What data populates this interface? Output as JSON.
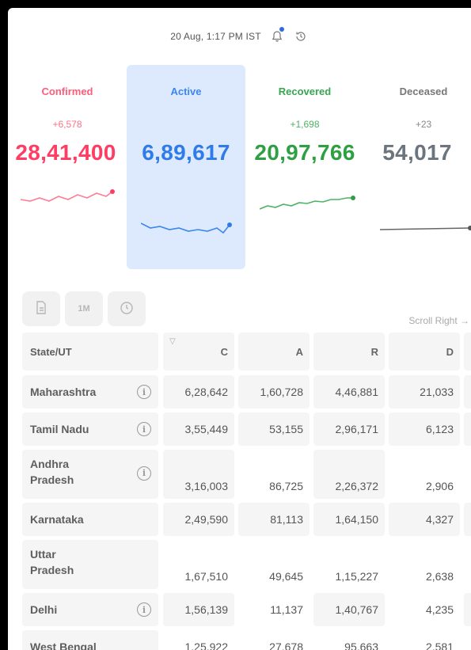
{
  "header": {
    "timestamp": "20 Aug, 1:17 PM IST"
  },
  "stats": [
    {
      "label": "Confirmed",
      "delta": "+6,578",
      "value": "28,41,400",
      "color": "#ff3d63"
    },
    {
      "label": "Active",
      "delta": "",
      "value": "6,89,617",
      "color": "#2f7be9"
    },
    {
      "label": "Recovered",
      "delta": "+1,698",
      "value": "20,97,766",
      "color": "#2ea043"
    },
    {
      "label": "Deceased",
      "delta": "+23",
      "value": "54,017",
      "color": "#6c757d"
    }
  ],
  "toolbar": {
    "period_label": "1M",
    "scroll_hint": "Scroll Right →"
  },
  "table": {
    "headers": [
      "State/UT",
      "C",
      "A",
      "R",
      "D"
    ],
    "rows": [
      {
        "state": "Maharashtra",
        "c": "6,28,642",
        "a": "1,60,728",
        "r": "4,46,881",
        "d": "21,033"
      },
      {
        "state": "Tamil Nadu",
        "c": "3,55,449",
        "a": "53,155",
        "r": "2,96,171",
        "d": "6,123"
      },
      {
        "state": "Andhra Pradesh",
        "c": "3,16,003",
        "a": "86,725",
        "r": "2,26,372",
        "d": "2,906"
      },
      {
        "state": "Karnataka",
        "c": "2,49,590",
        "a": "81,113",
        "r": "1,64,150",
        "d": "4,327"
      },
      {
        "state": "Uttar Pradesh",
        "c": "1,67,510",
        "a": "49,645",
        "r": "1,15,227",
        "d": "2,638"
      },
      {
        "state": "Delhi",
        "c": "1,56,139",
        "a": "11,137",
        "r": "1,40,767",
        "d": "4,235"
      },
      {
        "state": "West Bengal",
        "c": "1,25,922",
        "a": "27,678",
        "r": "95,663",
        "d": "2,581"
      }
    ]
  }
}
